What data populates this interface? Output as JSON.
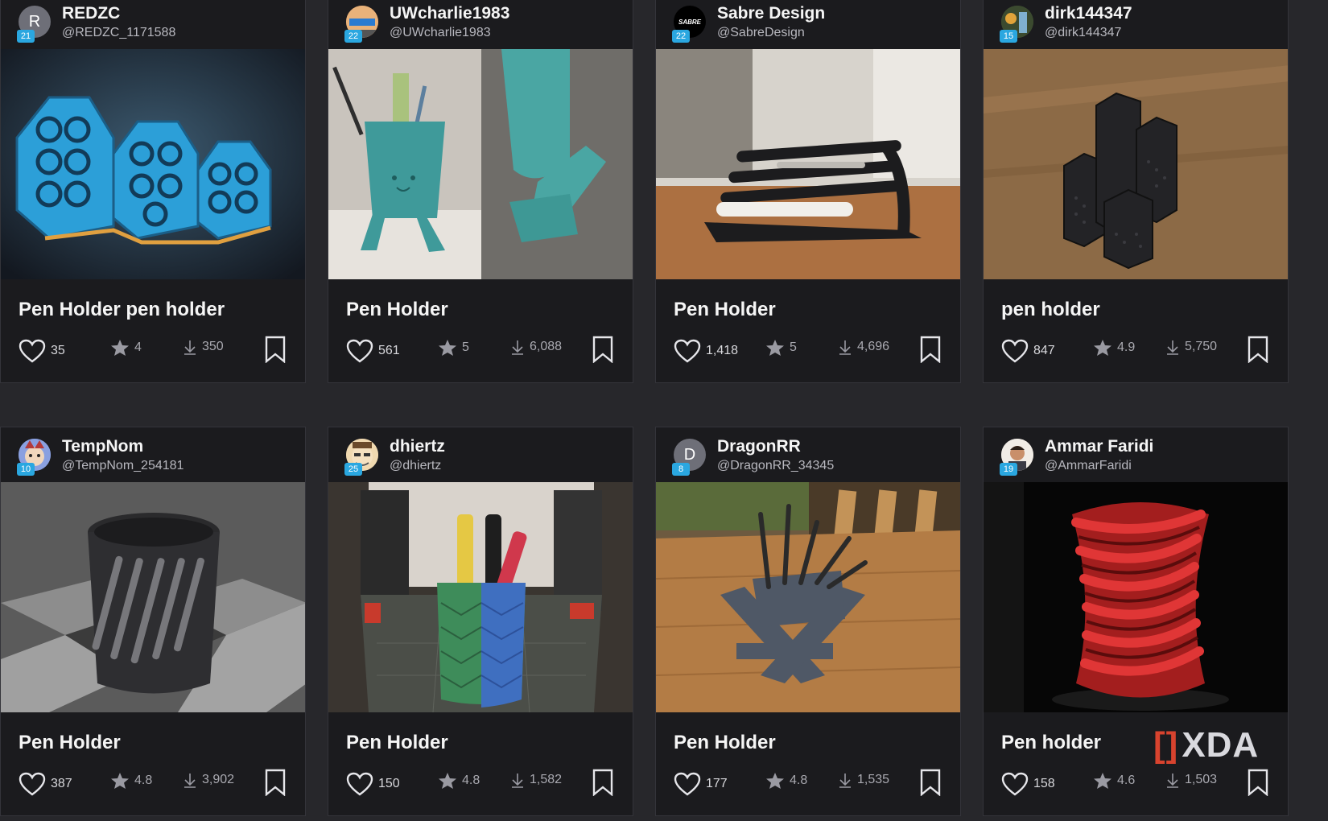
{
  "cards": [
    {
      "user": "REDZC",
      "handle": "@REDZC_1171588",
      "level": "21",
      "avatar_letter": "R",
      "title": "Pen Holder pen holder",
      "likes": "35",
      "rating": "4",
      "downloads": "350"
    },
    {
      "user": "UWcharlie1983",
      "handle": "@UWcharlie1983",
      "level": "22",
      "avatar_letter": "",
      "title": "Pen Holder",
      "likes": "561",
      "rating": "5",
      "downloads": "6,088"
    },
    {
      "user": "Sabre Design",
      "handle": "@SabreDesign",
      "level": "22",
      "avatar_letter": "SABRE",
      "title": "Pen Holder",
      "likes": "1,418",
      "rating": "5",
      "downloads": "4,696"
    },
    {
      "user": "dirk144347",
      "handle": "@dirk144347",
      "level": "15",
      "avatar_letter": "",
      "title": "pen holder",
      "likes": "847",
      "rating": "4.9",
      "downloads": "5,750"
    },
    {
      "user": "TempNom",
      "handle": "@TempNom_254181",
      "level": "10",
      "avatar_letter": "",
      "title": "Pen Holder",
      "likes": "387",
      "rating": "4.8",
      "downloads": "3,902"
    },
    {
      "user": "dhiertz",
      "handle": "@dhiertz",
      "level": "25",
      "avatar_letter": "",
      "title": "Pen Holder",
      "likes": "150",
      "rating": "4.8",
      "downloads": "1,582"
    },
    {
      "user": "DragonRR",
      "handle": "@DragonRR_34345",
      "level": "8",
      "avatar_letter": "D",
      "title": "Pen Holder",
      "likes": "177",
      "rating": "4.8",
      "downloads": "1,535"
    },
    {
      "user": "Ammar Faridi",
      "handle": "@AmmarFaridi",
      "level": "19",
      "avatar_letter": "",
      "title": "Pen holder",
      "likes": "158",
      "rating": "4.6",
      "downloads": "1,503"
    }
  ],
  "watermark": {
    "bracket": "[]",
    "text": "XDA"
  },
  "colors": {
    "badge": "#2aa7e0",
    "card_bg": "#1b1b1e",
    "page_bg": "#27272b"
  },
  "icons": [
    "heart-icon",
    "star-icon",
    "download-icon",
    "bookmark-icon"
  ]
}
